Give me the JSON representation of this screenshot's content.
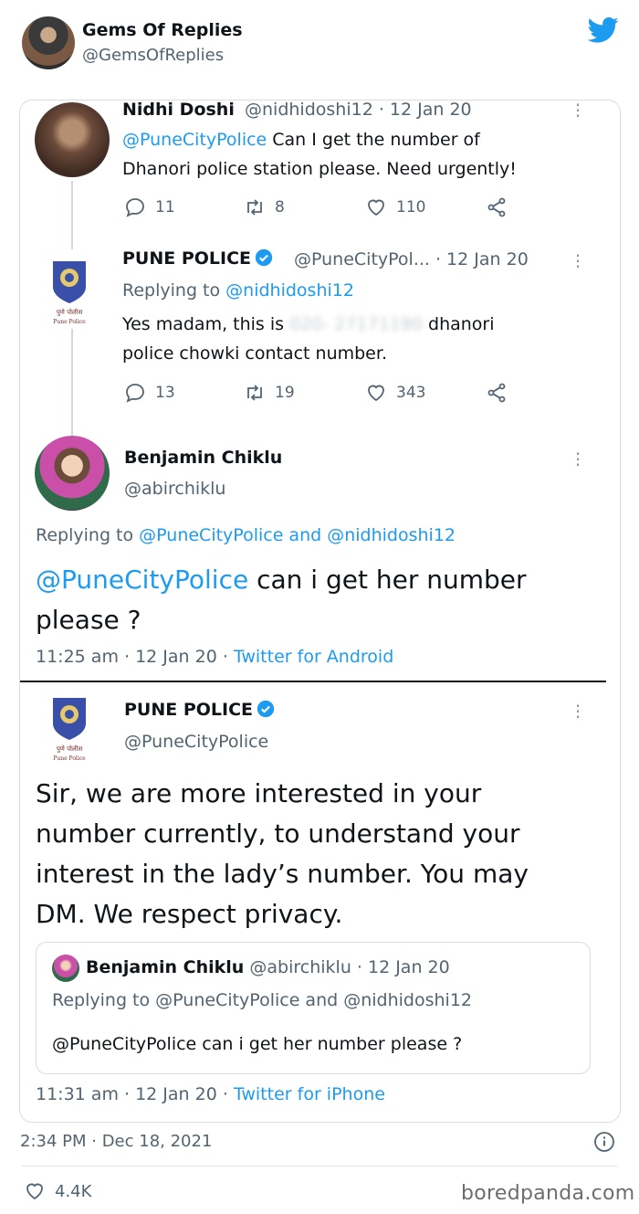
{
  "header": {
    "name": "Gems Of Replies",
    "handle": "@GemsOfReplies"
  },
  "tweet1": {
    "name": "Nidhi Doshi",
    "meta": "@nidhidoshi12 · 12 Jan 20",
    "mention": "@PuneCityPolice",
    "text_after_mention": " Can I get the number of",
    "text_line2": "Dhanori police station please. Need urgently!",
    "replies": "11",
    "retweets": "8",
    "likes": "110"
  },
  "tweet2": {
    "name": "PUNE POLICE",
    "meta": "@PuneCityPol... · 12 Jan 20",
    "replying_prefix": "Replying to ",
    "replying_handle": "@nidhidoshi12",
    "text_part1": "Yes madam, this is",
    "redacted_number": "020- 27171190",
    "text_part2": "dhanori",
    "text_line2": "police chowki contact number.",
    "replies": "13",
    "retweets": "19",
    "likes": "343",
    "logo_text": "पुणे पोलीस Pune Police"
  },
  "tweet3": {
    "name": "Benjamin Chiklu",
    "handle": "@abirchiklu",
    "replying_prefix": "Replying to ",
    "replying_handles": "@PuneCityPolice and @nidhidoshi12",
    "mention": "@PuneCityPolice",
    "text_after_mention": " can i get her number",
    "text_line2": "please ?",
    "time": "11:25 am · 12 Jan 20 · ",
    "source": "Twitter for Android"
  },
  "tweet4": {
    "name": "PUNE POLICE",
    "handle": "@PuneCityPolice",
    "text_line1": "Sir, we are more interested in your",
    "text_line2": "number currently, to understand your",
    "text_line3": "interest in the lady’s number. You may",
    "text_line4": "DM. We respect privacy.",
    "time": "11:31 am · 12 Jan 20 · ",
    "source": "Twitter for iPhone"
  },
  "quote": {
    "name": "Benjamin Chiklu",
    "meta": "@abirchiklu · 12 Jan 20",
    "replying": "Replying to @PuneCityPolice and @nidhidoshi12",
    "text": "@PuneCityPolice can i get her number please ?"
  },
  "footer": {
    "timestamp": "2:34 PM · Dec 18, 2021",
    "likes": "4.4K",
    "watermark": "boredpanda.com"
  },
  "colors": {
    "link_blue": "#1d9bf0",
    "gray_text": "#536471",
    "twitter_blue": "#1d9bf0"
  }
}
